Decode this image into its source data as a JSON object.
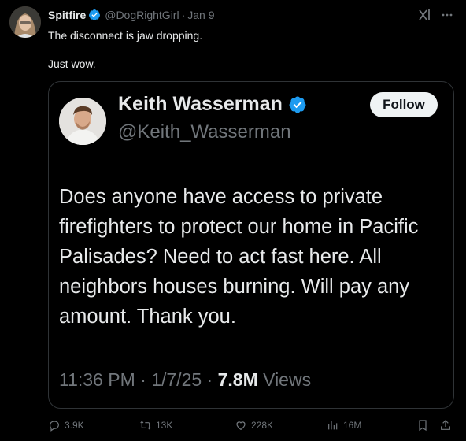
{
  "outer_tweet": {
    "author_name": "Spitfire",
    "handle": "@DogRightGirl",
    "separator": "·",
    "date": "Jan 9",
    "text_line1": "The disconnect is jaw dropping.",
    "text_line2": "Just wow."
  },
  "quoted_tweet": {
    "author_name": "Keith Wasserman",
    "handle": "@Keith_Wasserman",
    "follow_label": "Follow",
    "body": "Does anyone have access to private firefighters to protect our home in Pacific Palisades? Need to act fast here. All neighbors houses burning. Will pay any amount. Thank you.",
    "time": "11:36 PM",
    "sep": "·",
    "date": "1/7/25",
    "views_count": "7.8M",
    "views_label": "Views"
  },
  "actions": {
    "replies": "3.9K",
    "retweets": "13K",
    "likes": "228K",
    "views": "16M"
  },
  "icons": {
    "verified": "verified-badge-icon",
    "grok": "grok-icon",
    "more": "more-icon",
    "reply": "reply-icon",
    "retweet": "retweet-icon",
    "like": "heart-icon",
    "views": "views-icon",
    "bookmark": "bookmark-icon",
    "share": "share-icon"
  },
  "colors": {
    "background": "#000000",
    "text": "#e7e9ea",
    "muted": "#71767b",
    "verified": "#1d9bf0",
    "border": "#2f3336"
  }
}
